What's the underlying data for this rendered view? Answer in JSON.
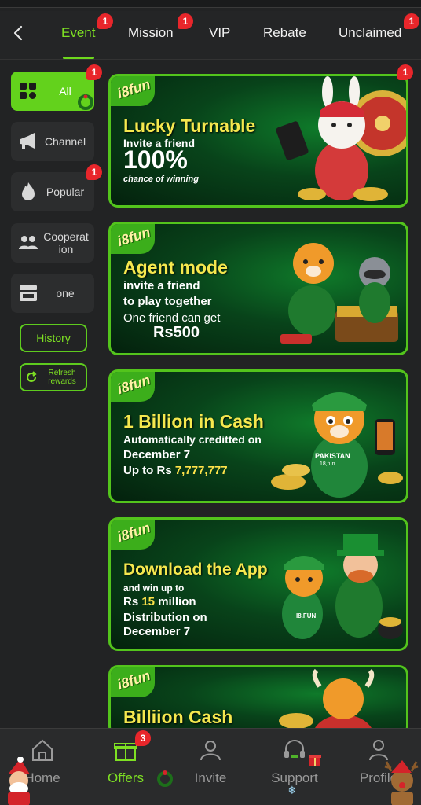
{
  "tabs": [
    {
      "label": "Event",
      "badge": "1",
      "active": true
    },
    {
      "label": "Mission",
      "badge": "1"
    },
    {
      "label": "VIP"
    },
    {
      "label": "Rebate"
    },
    {
      "label": "Unclaimed",
      "badge": "1"
    }
  ],
  "sidebar": {
    "items": [
      {
        "label": "All",
        "badge": "1",
        "icon": "grid-icon",
        "active": true
      },
      {
        "label": "Channel",
        "icon": "megaphone-icon"
      },
      {
        "label": "Popular",
        "badge": "1",
        "icon": "fire-icon"
      },
      {
        "label": "Cooperation",
        "icon": "handshake-icon"
      },
      {
        "label": "one",
        "icon": "cashier-icon"
      }
    ],
    "history_label": "History",
    "refresh_label": "Refresh rewards"
  },
  "banners": [
    {
      "logo": "i8fun",
      "badge": "1",
      "title": "Lucky Turnable",
      "line1": "Invite a friend",
      "line2": "100%",
      "line3": "chance of winning"
    },
    {
      "logo": "i8fun",
      "title": "Agent mode",
      "line1": "invite a friend",
      "line2": "to play together",
      "line3": "One friend can get",
      "line4": "Rs500"
    },
    {
      "logo": "i8fun",
      "title": "1 Billion in Cash",
      "line1": "Automatically creditted on",
      "line2": "December 7",
      "line3_prefix": "Up to Rs ",
      "line3_value": "7,777,777",
      "shirt_text": "PAKISTAN",
      "shirt_sub": "18,fun"
    },
    {
      "logo": "i8fun",
      "title": "Download the App",
      "line1": "and win up to",
      "line2_prefix": "Rs ",
      "line2_value": "15",
      "line2_suffix": " million",
      "line3": "Distribution on",
      "line4": "December 7",
      "shirt_text": "I8.FUN"
    },
    {
      "logo": "i8fun",
      "title": "Billiion Cash"
    }
  ],
  "bottom_nav": [
    {
      "label": "Home",
      "icon": "home-icon"
    },
    {
      "label": "Offers",
      "icon": "gift-icon",
      "badge": "3",
      "active": true
    },
    {
      "label": "Invite",
      "icon": "people-icon"
    },
    {
      "label": "Support",
      "icon": "headset-icon"
    },
    {
      "label": "Profile",
      "icon": "profile-icon"
    }
  ],
  "colors": {
    "accent": "#63d21c",
    "badge": "#e8262b",
    "title_yellow": "#f5e84e",
    "background": "#222324"
  }
}
